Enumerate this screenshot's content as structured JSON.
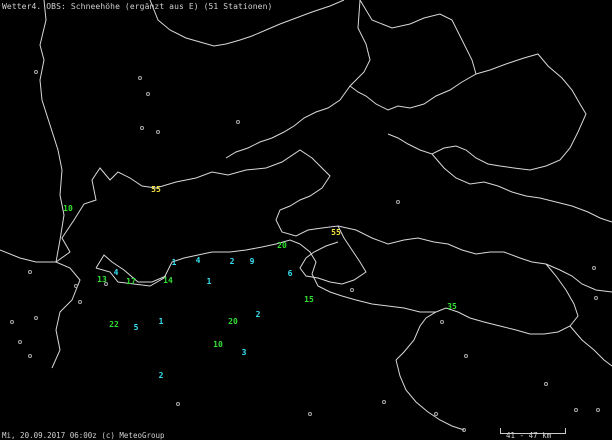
{
  "title": "Wetter4. OBS: Schneehöhe (ergänzt aus E) (51 Stationen)",
  "footer": "Mi, 20.09.2017 06:00z (c) MeteoGroup",
  "scale_label": "41 - 47 km",
  "colors": {
    "background": "#000000",
    "border": "#d8d8d8",
    "cyan": "#36e0f0",
    "green": "#30e030",
    "yellow": "#f0e040",
    "dot": "#aaaaaa"
  },
  "stations": [
    {
      "value": "55",
      "color": "yellow"
    },
    {
      "value": "10",
      "color": "green"
    },
    {
      "value": "55",
      "color": "yellow"
    },
    {
      "value": "20",
      "color": "green"
    },
    {
      "value": "1",
      "color": "cyan"
    },
    {
      "value": "4",
      "color": "cyan"
    },
    {
      "value": "2",
      "color": "cyan"
    },
    {
      "value": "9",
      "color": "cyan"
    },
    {
      "value": "6",
      "color": "cyan"
    },
    {
      "value": "4",
      "color": "cyan"
    },
    {
      "value": "13",
      "color": "green"
    },
    {
      "value": "17",
      "color": "green"
    },
    {
      "value": "14",
      "color": "green"
    },
    {
      "value": "1",
      "color": "cyan"
    },
    {
      "value": "15",
      "color": "green"
    },
    {
      "value": "35",
      "color": "green"
    },
    {
      "value": "2",
      "color": "cyan"
    },
    {
      "value": "22",
      "color": "green"
    },
    {
      "value": "5",
      "color": "cyan"
    },
    {
      "value": "1",
      "color": "cyan"
    },
    {
      "value": "20",
      "color": "green"
    },
    {
      "value": "10",
      "color": "green"
    },
    {
      "value": "3",
      "color": "cyan"
    },
    {
      "value": "2",
      "color": "cyan"
    }
  ]
}
